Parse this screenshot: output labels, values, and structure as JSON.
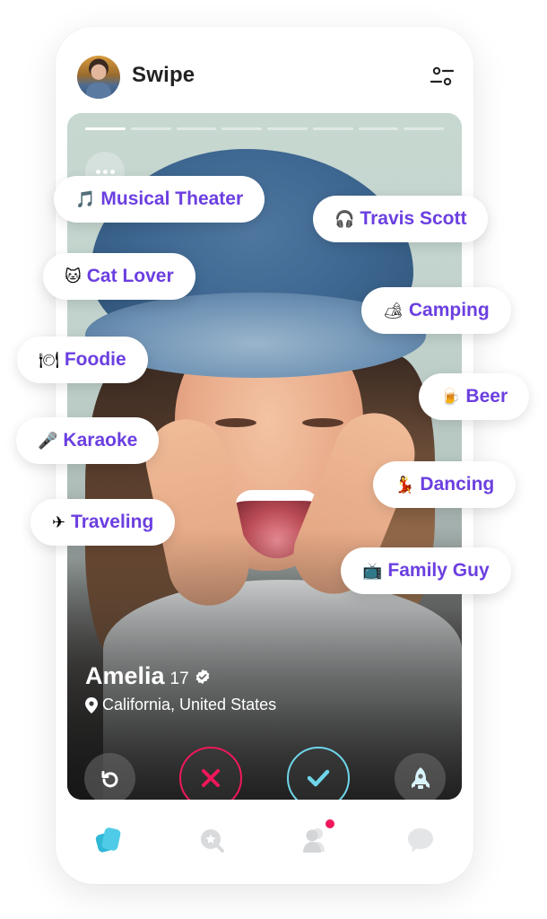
{
  "header": {
    "title": "Swipe",
    "avatar_alt": "user-avatar",
    "filter_icon": "sliders-icon"
  },
  "card": {
    "photo_count": 8,
    "active_photo": 1,
    "profile": {
      "name": "Amelia",
      "age": "17",
      "verified": true,
      "location": "California, United States"
    }
  },
  "tags": [
    {
      "emoji": "🎵",
      "label": "Musical Theater"
    },
    {
      "emoji": "🎧",
      "label": "Travis Scott"
    },
    {
      "emoji": "🐱",
      "label": "Cat Lover"
    },
    {
      "emoji": "🏕",
      "label": "Camping"
    },
    {
      "emoji": "🍽",
      "label": "Foodie"
    },
    {
      "emoji": "🍺",
      "label": "Beer"
    },
    {
      "emoji": "🎤",
      "label": "Karaoke"
    },
    {
      "emoji": "💃",
      "label": "Dancing"
    },
    {
      "emoji": "✈",
      "label": "Traveling"
    },
    {
      "emoji": "📺",
      "label": "Family Guy"
    }
  ],
  "actions": [
    {
      "name": "undo",
      "icon": "undo-icon"
    },
    {
      "name": "nope",
      "icon": "close-icon"
    },
    {
      "name": "like",
      "icon": "check-icon"
    },
    {
      "name": "boost",
      "icon": "rocket-icon"
    }
  ],
  "tabbar": [
    {
      "name": "swipe",
      "icon": "cards-icon",
      "active": true
    },
    {
      "name": "discover",
      "icon": "star-search-icon",
      "active": false
    },
    {
      "name": "matches",
      "icon": "people-icon",
      "active": false,
      "badge": true
    },
    {
      "name": "chat",
      "icon": "chat-bubble-icon",
      "active": false
    }
  ],
  "colors": {
    "accent_purple": "#6b3fe0",
    "nope_red": "#f0185a",
    "like_cyan": "#6fd6ea",
    "tab_active": "#3dbfe0",
    "tab_inactive": "#d8dadc"
  }
}
